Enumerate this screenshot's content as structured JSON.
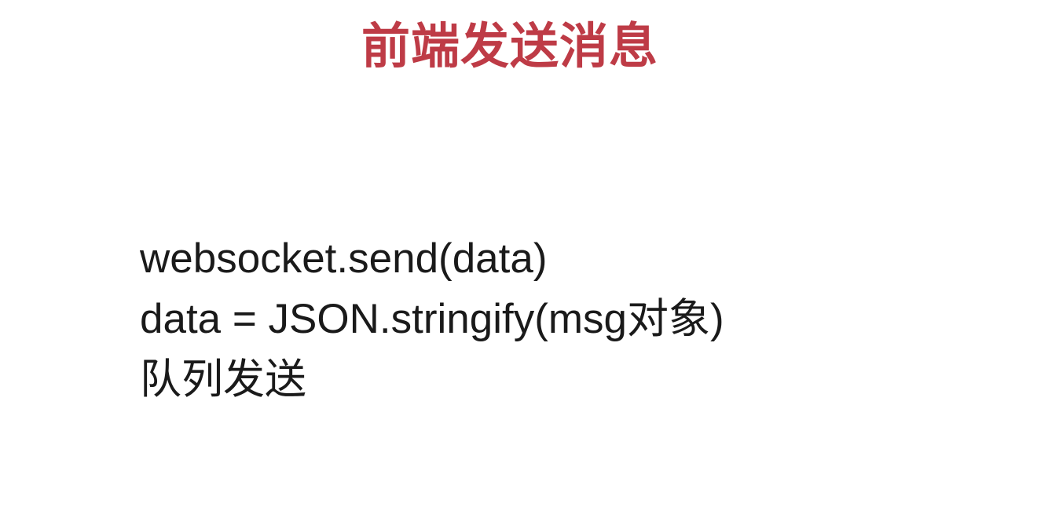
{
  "slide": {
    "title": "前端发送消息",
    "lines": {
      "line1": "websocket.send(data)",
      "line2": "data = JSON.stringify(msg对象)",
      "line3": "队列发送"
    }
  }
}
